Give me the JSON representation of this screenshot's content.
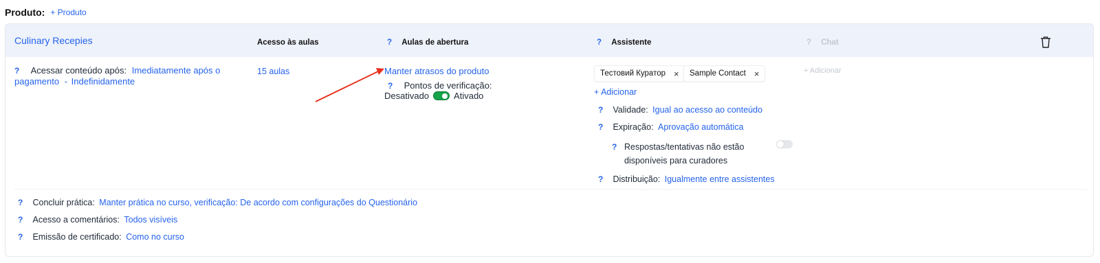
{
  "top": {
    "label": "Produto:",
    "add_link": "+ Produto"
  },
  "header": {
    "course_title": "Culinary Recepies",
    "col_access": "Acesso às aulas",
    "col_opening": "Aulas de abertura",
    "col_assistant": "Assistente",
    "col_chat": "Chat",
    "help_mark": "?"
  },
  "row": {
    "access_label": "Acessar conteúdo após:",
    "access_value_1": "Imediatamente após o pagamento",
    "access_sep": "-",
    "access_value_2": "Indefinidamente",
    "lessons": "15 aulas",
    "delays_link": "Manter atrasos do produto",
    "checkpoints_label": "Pontos de verificação:",
    "toggle_off_label": "Desativado",
    "toggle_on_label": "Ativado",
    "assistants": [
      {
        "name": "Тестовий Куратор",
        "remove": "×"
      },
      {
        "name": "Sample Contact",
        "remove": "×"
      }
    ],
    "add_assistant": "+ Adicionar",
    "add_chat": "+ Adicionar",
    "validity_label": "Validade:",
    "validity_value": "Igual ao acesso ao conteúdo",
    "expiration_label": "Expiração:",
    "expiration_value": "Aprovação automática",
    "responses_label": "Respostas/tentativas não estão disponíveis para curadores",
    "responses_enabled": false,
    "distribution_label": "Distribuição:",
    "distribution_value": "Igualmente entre assistentes"
  },
  "bottom": {
    "practice_label": "Concluir prática:",
    "practice_value": "Manter prática no curso, verificação: De acordo com configurações do Questionário",
    "comments_label": "Acesso a comentários:",
    "comments_value": "Todos visíveis",
    "certificate_label": "Emissão de certificado:",
    "certificate_value": "Como no curso"
  },
  "colors": {
    "link": "#2563eb",
    "header_bg": "#eef2fb",
    "toggle_on": "#16a34a",
    "arrow": "#e8321f",
    "disabled": "#c4c8d0"
  },
  "icons": {
    "delete": "trash-icon",
    "arrow": "annotation-arrow",
    "help": "help-icon"
  }
}
